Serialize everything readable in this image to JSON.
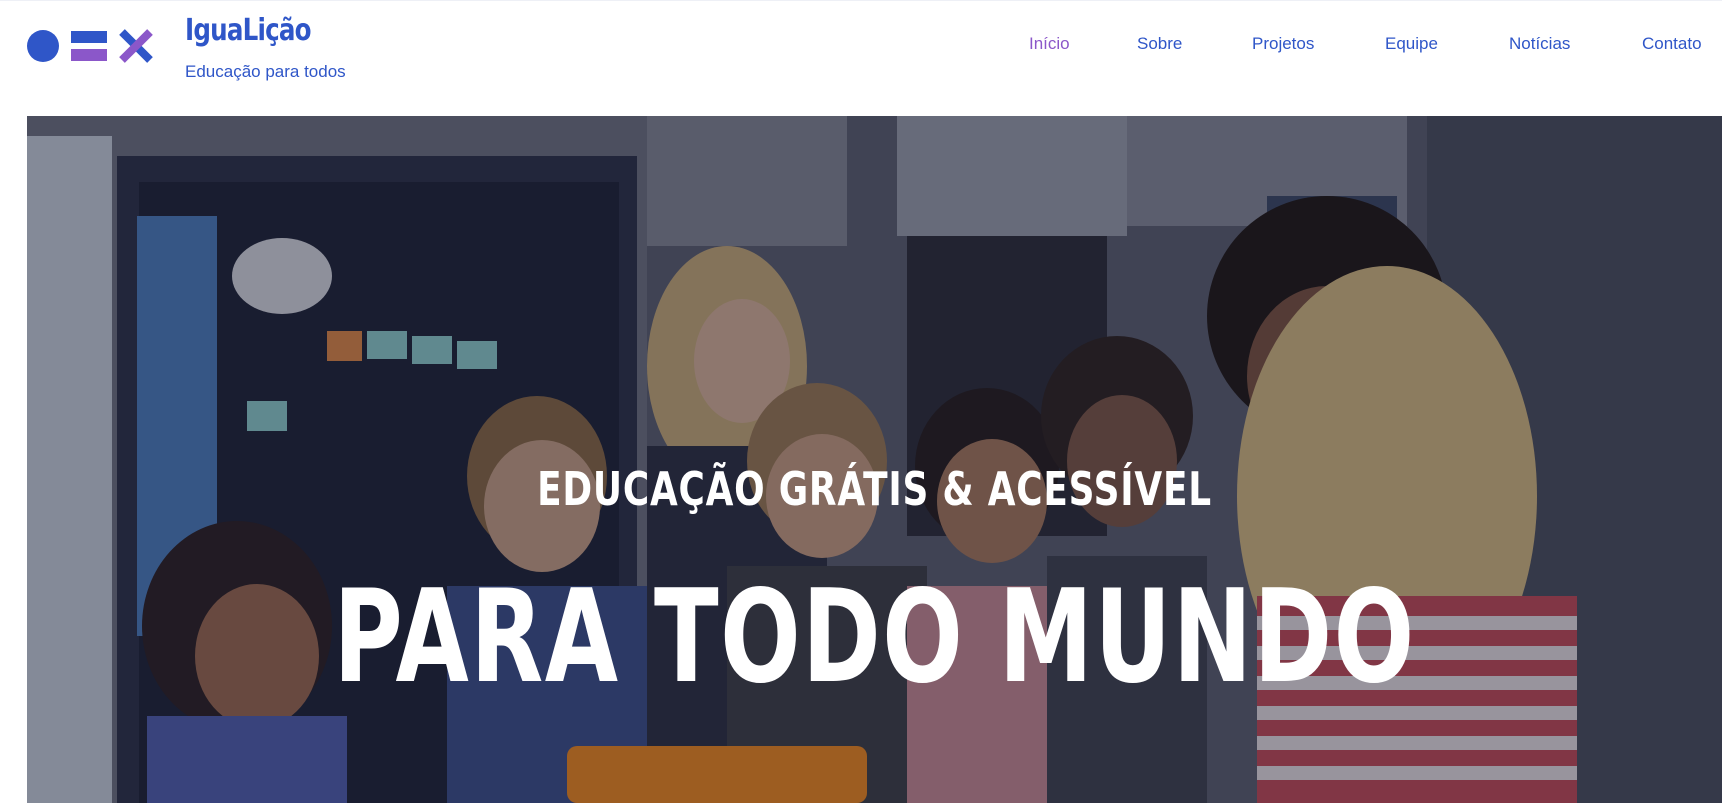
{
  "brand": {
    "name": "IguaLição",
    "tagline": "Educação para todos",
    "logo_icons": [
      "circle-icon",
      "equals-icon",
      "times-icon"
    ],
    "colors": {
      "blue": "#2f56c8",
      "purple": "#8b57c9"
    }
  },
  "nav": {
    "items": [
      {
        "label": "Início",
        "active": true
      },
      {
        "label": "Sobre",
        "active": false
      },
      {
        "label": "Projetos",
        "active": false
      },
      {
        "label": "Equipe",
        "active": false
      },
      {
        "label": "Notícias",
        "active": false
      },
      {
        "label": "Contato",
        "active": false
      }
    ]
  },
  "hero": {
    "subtitle": "EDUCAÇÃO GRÁTIS & ACESSÍVEL",
    "title": "PARA TODO MUNDO",
    "image_subject": "classroom photo of a teacher and children gathered around a table"
  }
}
